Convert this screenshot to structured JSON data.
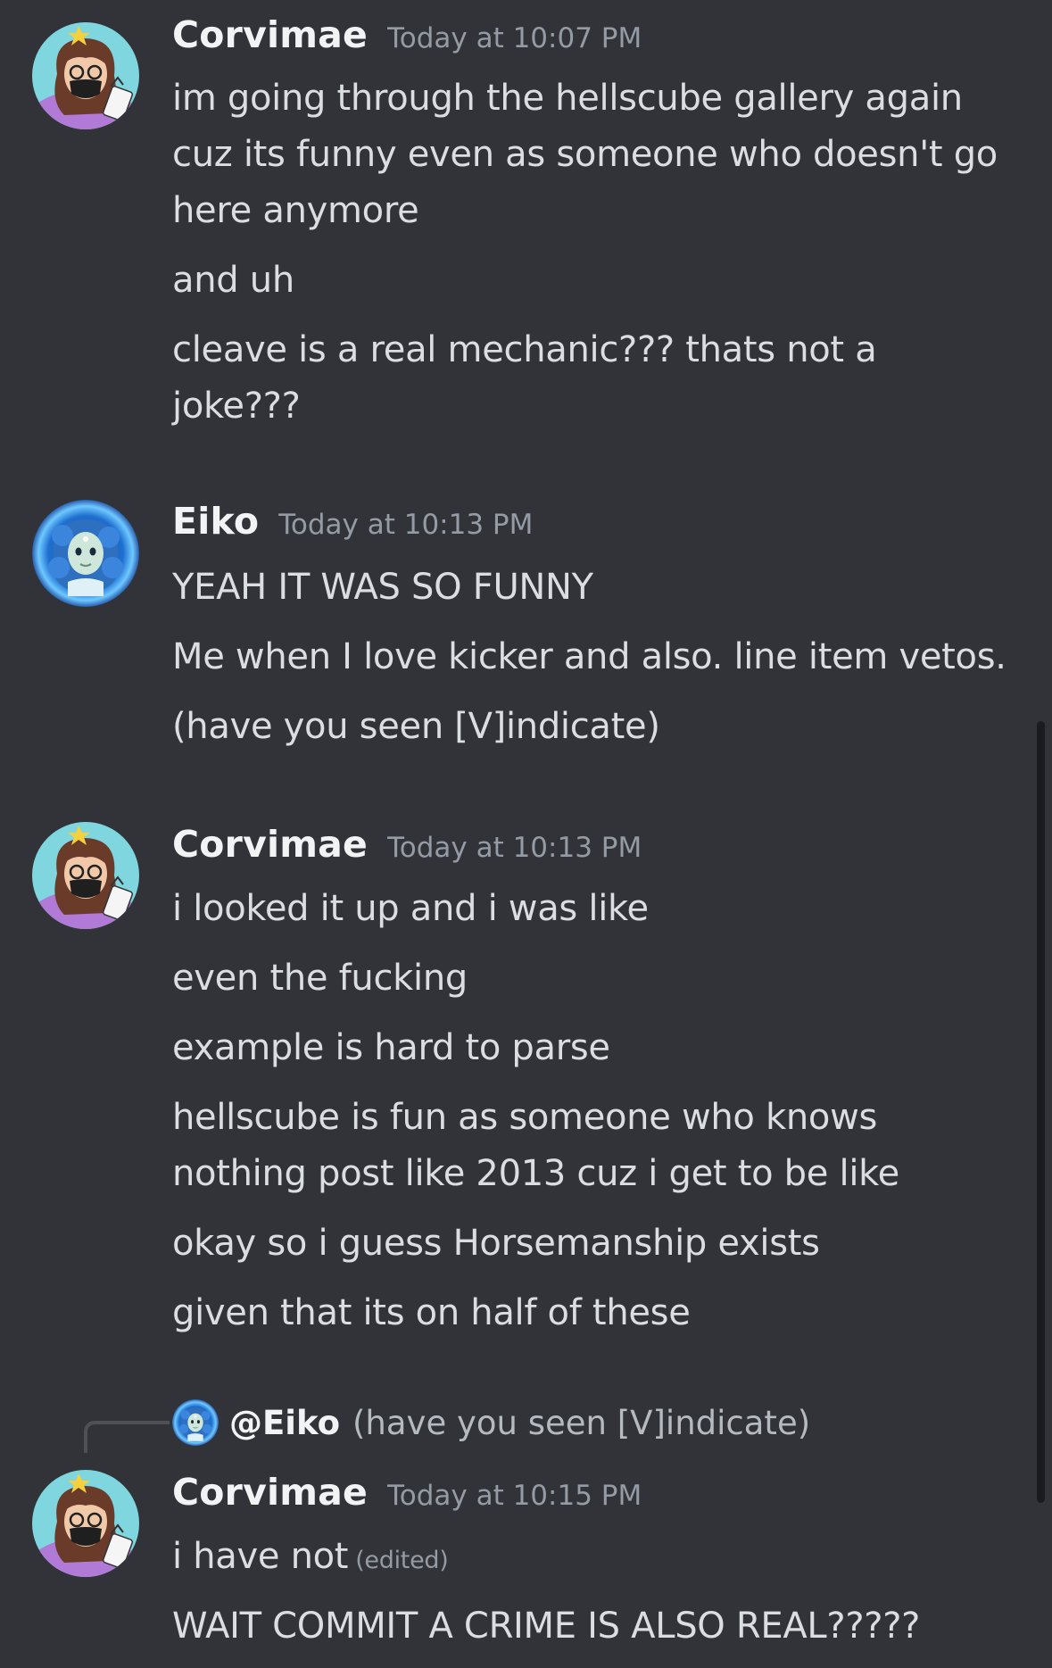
{
  "messages": [
    {
      "author": "Corvimae",
      "timestamp": "Today at 10:07 PM",
      "lines": [
        "im going through the hellscube gallery again cuz its funny even as someone who doesn't go here anymore",
        "and uh",
        "cleave is a real mechanic??? thats not a joke???"
      ]
    },
    {
      "author": "Eiko",
      "timestamp": "Today at 10:13 PM",
      "lines": [
        "YEAH IT WAS SO FUNNY",
        "Me when I love kicker and also. line item vetos.",
        "(have you seen [V]indicate)"
      ]
    },
    {
      "author": "Corvimae",
      "timestamp": "Today at 10:13 PM",
      "lines": [
        "i looked it up and i was like",
        "even the fucking",
        "example is hard to parse",
        "hellscube is fun as someone who knows nothing post like 2013 cuz i get to be like",
        "okay so i guess Horsemanship exists",
        "given that its on half of these"
      ]
    },
    {
      "author": "Corvimae",
      "timestamp": "Today at 10:15 PM",
      "reply": {
        "mention": "@Eiko",
        "text": "(have you seen [V]indicate)"
      },
      "lines": [
        "i have not",
        "WAIT COMMIT A CRIME IS ALSO REAL?????"
      ],
      "edited_label": "(edited)"
    }
  ],
  "colors": {
    "background": "#313338",
    "username": "#f2f3f5",
    "timestamp": "#949ba4",
    "message_text": "#dbdee1"
  },
  "icons": {
    "corvimae_avatar": "avatar-corvimae-icon",
    "eiko_avatar": "avatar-eiko-icon"
  }
}
